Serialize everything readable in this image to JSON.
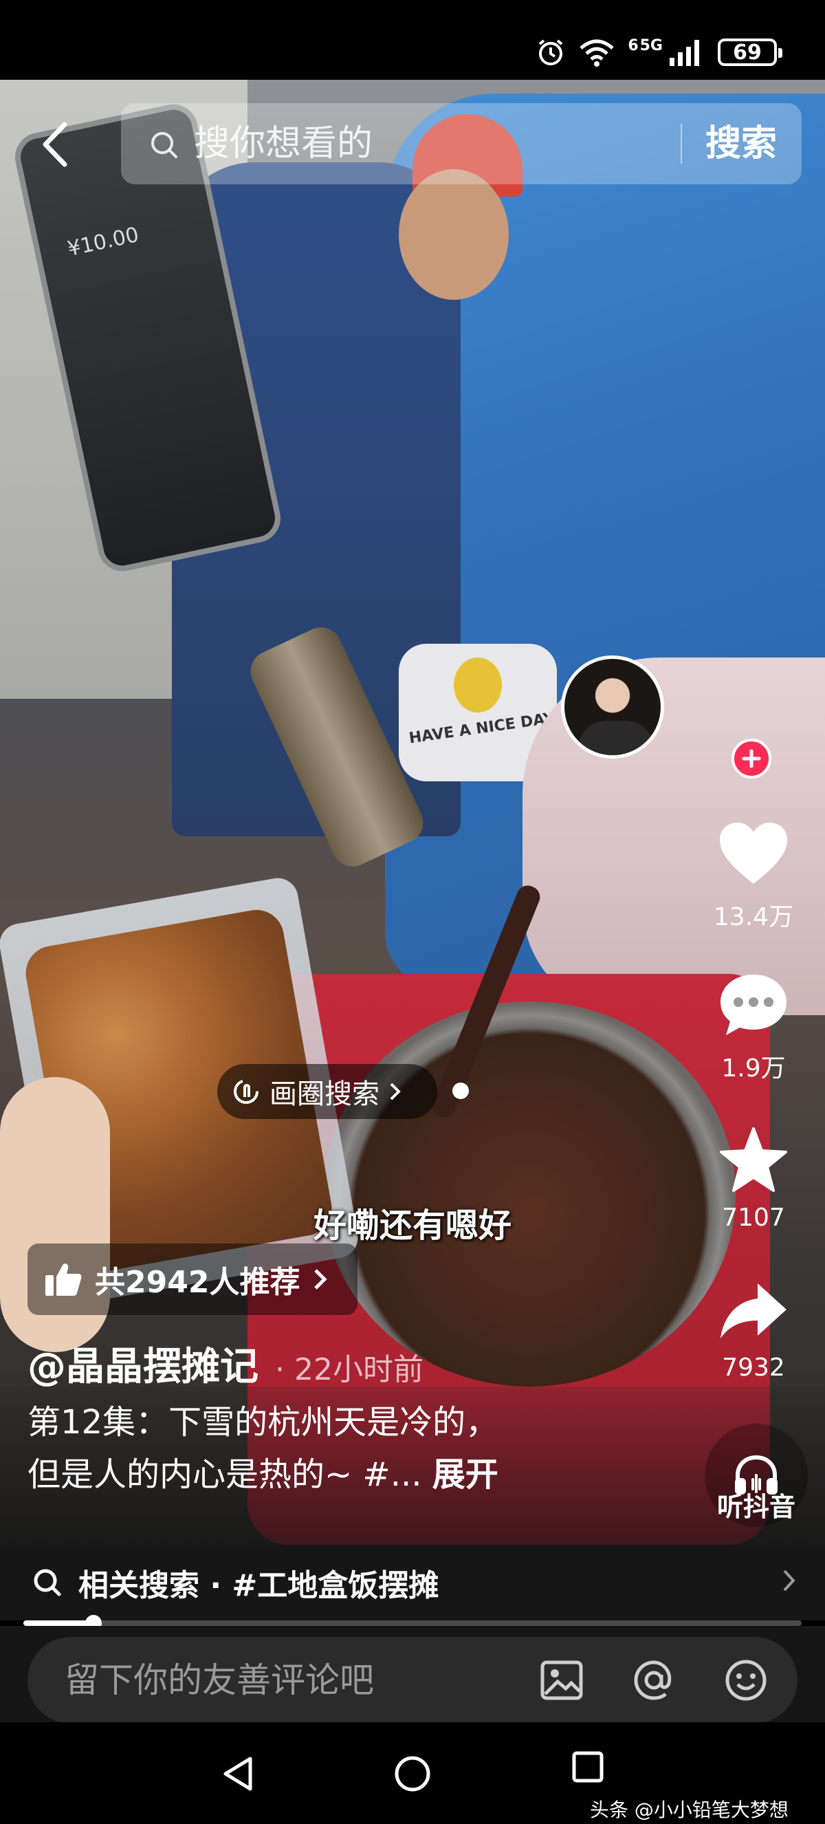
{
  "status_bar": {
    "network": "5G",
    "signal_label": "6",
    "battery": "69"
  },
  "search": {
    "placeholder": "搜你想看的",
    "button_label": "搜索"
  },
  "video": {
    "phone_amount": "¥10.00",
    "bag_text": "HAVE A NICE DAY!"
  },
  "rail": {
    "like_count": "13.4万",
    "comment_count": "1.9万",
    "favorite_count": "7107",
    "share_count": "7932",
    "listen_label": "听抖音"
  },
  "circle_search": {
    "label": "画圈搜索"
  },
  "subtitle": "好嘞还有嗯好",
  "recommend": {
    "label": "共2942人推荐"
  },
  "post": {
    "author": "@晶晶摆摊记",
    "time_ago": "· 22小时前",
    "description_line1": "第12集：下雪的杭州天是冷的，",
    "description_line2": "但是人的内心是热的~ #...",
    "expand_label": "展开"
  },
  "related_search": {
    "label": "相关搜索 · #工地盒饭摆摊"
  },
  "progress": {
    "fraction": 0.09
  },
  "comment": {
    "placeholder": "留下你的友善评论吧"
  },
  "watermark": "头条 @小小铅笔大梦想",
  "colors": {
    "accent": "#fe2c55",
    "bar_bg": "#161616",
    "input_bg": "#2b2b2b"
  }
}
